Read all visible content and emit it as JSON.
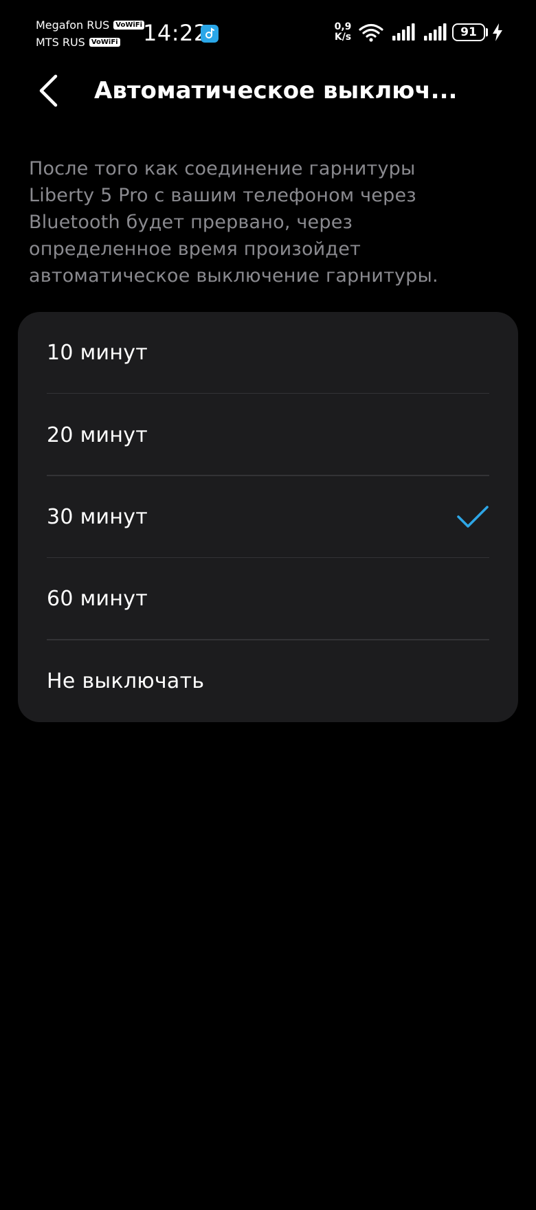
{
  "status_bar": {
    "carrier_1": "Megafon RUS",
    "carrier_2": "MTS RUS",
    "vowifi_label": "VoWiFi",
    "time": "14:22",
    "net_speed_value": "0,9",
    "net_speed_unit": "K/s",
    "battery": "91",
    "icons": [
      "app-notification-icon",
      "wifi-icon",
      "signal-icon",
      "signal-icon",
      "battery-icon",
      "charging-bolt-icon"
    ]
  },
  "header": {
    "title": "Автоматическое выключ...",
    "back_icon": "chevron-left-icon"
  },
  "description": "После того как соединение гарнитуры Liberty 5 Pro с вашим телефоном через Bluetooth будет прервано, через определенное время произойдет автоматическое выключение гарнитуры.",
  "options": [
    {
      "label": "10 минут",
      "selected": false
    },
    {
      "label": "20 минут",
      "selected": false
    },
    {
      "label": "30 минут",
      "selected": true
    },
    {
      "label": "60 минут",
      "selected": false
    },
    {
      "label": "Не выключать",
      "selected": false
    }
  ],
  "colors": {
    "background": "#000000",
    "card": "#1c1c1e",
    "description_text": "#8a8a8f",
    "accent_check": "#2ea6e6",
    "divider": "#333336"
  }
}
